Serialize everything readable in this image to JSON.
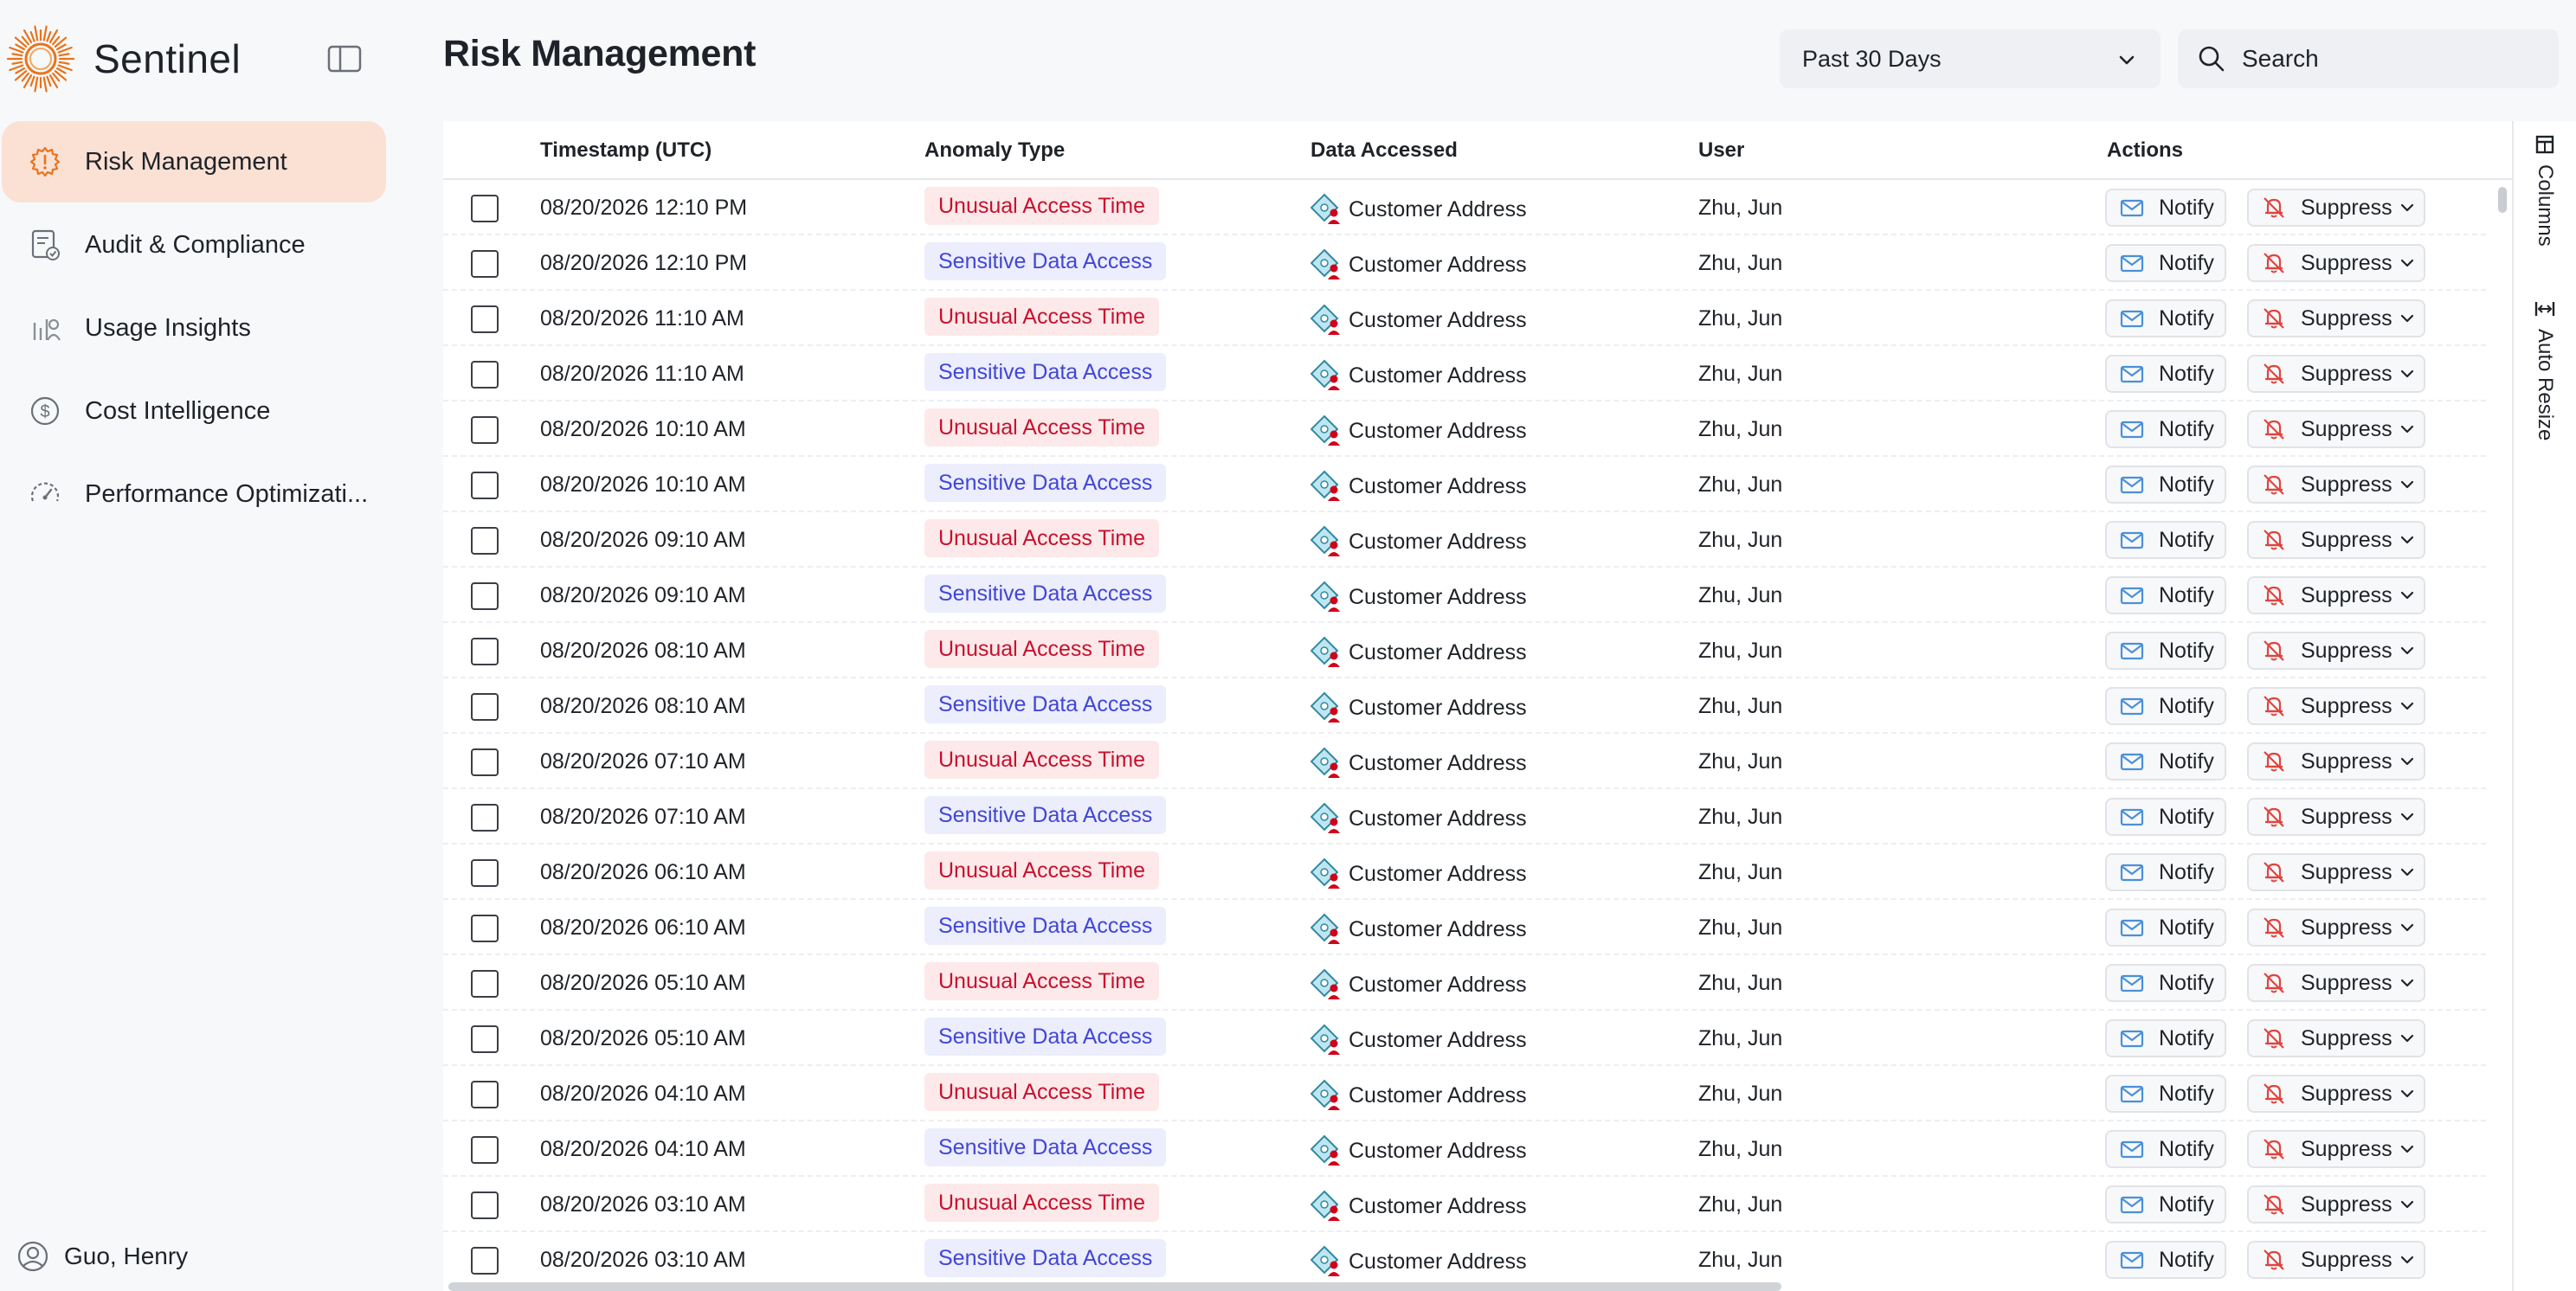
{
  "app": {
    "name": "Sentinel"
  },
  "sidebar": {
    "items": [
      {
        "label": "Risk Management",
        "icon": "gear-alert-icon",
        "active": true
      },
      {
        "label": "Audit & Compliance",
        "icon": "clipboard-check-icon",
        "active": false
      },
      {
        "label": "Usage Insights",
        "icon": "bar-chart-icon",
        "active": false
      },
      {
        "label": "Cost Intelligence",
        "icon": "dollar-icon",
        "active": false
      },
      {
        "label": "Performance Optimizati...",
        "icon": "speedometer-icon",
        "active": false
      }
    ],
    "user": "Guo, Henry"
  },
  "header": {
    "title": "Risk Management",
    "date_range": "Past 30 Days",
    "search_placeholder": "Search"
  },
  "table": {
    "columns": [
      "Timestamp (UTC)",
      "Anomaly Type",
      "Data Accessed",
      "User",
      "Actions"
    ],
    "notify_label": "Notify",
    "suppress_label": "Suppress",
    "rows": [
      {
        "timestamp": "08/20/2026 12:10 PM",
        "anomaly": "Unusual Access Time",
        "data": "Customer Address",
        "user": "Zhu, Jun"
      },
      {
        "timestamp": "08/20/2026 12:10 PM",
        "anomaly": "Sensitive Data Access",
        "data": "Customer Address",
        "user": "Zhu, Jun"
      },
      {
        "timestamp": "08/20/2026 11:10 AM",
        "anomaly": "Unusual Access Time",
        "data": "Customer Address",
        "user": "Zhu, Jun"
      },
      {
        "timestamp": "08/20/2026 11:10 AM",
        "anomaly": "Sensitive Data Access",
        "data": "Customer Address",
        "user": "Zhu, Jun"
      },
      {
        "timestamp": "08/20/2026 10:10 AM",
        "anomaly": "Unusual Access Time",
        "data": "Customer Address",
        "user": "Zhu, Jun"
      },
      {
        "timestamp": "08/20/2026 10:10 AM",
        "anomaly": "Sensitive Data Access",
        "data": "Customer Address",
        "user": "Zhu, Jun"
      },
      {
        "timestamp": "08/20/2026 09:10 AM",
        "anomaly": "Unusual Access Time",
        "data": "Customer Address",
        "user": "Zhu, Jun"
      },
      {
        "timestamp": "08/20/2026 09:10 AM",
        "anomaly": "Sensitive Data Access",
        "data": "Customer Address",
        "user": "Zhu, Jun"
      },
      {
        "timestamp": "08/20/2026 08:10 AM",
        "anomaly": "Unusual Access Time",
        "data": "Customer Address",
        "user": "Zhu, Jun"
      },
      {
        "timestamp": "08/20/2026 08:10 AM",
        "anomaly": "Sensitive Data Access",
        "data": "Customer Address",
        "user": "Zhu, Jun"
      },
      {
        "timestamp": "08/20/2026 07:10 AM",
        "anomaly": "Unusual Access Time",
        "data": "Customer Address",
        "user": "Zhu, Jun"
      },
      {
        "timestamp": "08/20/2026 07:10 AM",
        "anomaly": "Sensitive Data Access",
        "data": "Customer Address",
        "user": "Zhu, Jun"
      },
      {
        "timestamp": "08/20/2026 06:10 AM",
        "anomaly": "Unusual Access Time",
        "data": "Customer Address",
        "user": "Zhu, Jun"
      },
      {
        "timestamp": "08/20/2026 06:10 AM",
        "anomaly": "Sensitive Data Access",
        "data": "Customer Address",
        "user": "Zhu, Jun"
      },
      {
        "timestamp": "08/20/2026 05:10 AM",
        "anomaly": "Unusual Access Time",
        "data": "Customer Address",
        "user": "Zhu, Jun"
      },
      {
        "timestamp": "08/20/2026 05:10 AM",
        "anomaly": "Sensitive Data Access",
        "data": "Customer Address",
        "user": "Zhu, Jun"
      },
      {
        "timestamp": "08/20/2026 04:10 AM",
        "anomaly": "Unusual Access Time",
        "data": "Customer Address",
        "user": "Zhu, Jun"
      },
      {
        "timestamp": "08/20/2026 04:10 AM",
        "anomaly": "Sensitive Data Access",
        "data": "Customer Address",
        "user": "Zhu, Jun"
      },
      {
        "timestamp": "08/20/2026 03:10 AM",
        "anomaly": "Unusual Access Time",
        "data": "Customer Address",
        "user": "Zhu, Jun"
      },
      {
        "timestamp": "08/20/2026 03:10 AM",
        "anomaly": "Sensitive Data Access",
        "data": "Customer Address",
        "user": "Zhu, Jun"
      }
    ]
  },
  "side_panel": {
    "columns_label": "Columns",
    "auto_resize_label": "Auto Resize"
  },
  "colors": {
    "accent": "#e8731a",
    "active_nav_bg": "#fbe0d4",
    "unusual_bg": "#fde9e9",
    "unusual_text": "#c8102e",
    "sensitive_bg": "#ecedfd",
    "sensitive_text": "#4146d6"
  }
}
